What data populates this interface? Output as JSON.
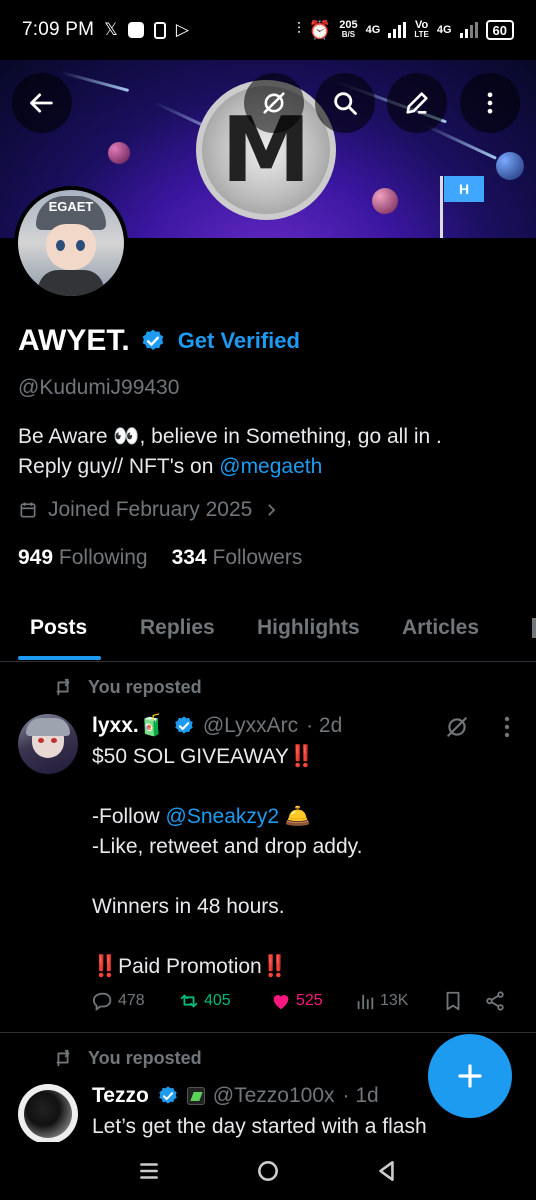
{
  "status_bar": {
    "time": "7:09 PM",
    "speed_top": "205",
    "speed_bottom": "B/S",
    "net1": "4G",
    "vo_top": "Vo",
    "vo_bottom": "LTE",
    "net2": "4G",
    "battery": "60"
  },
  "banner": {
    "back_icon": "arrow-left-icon",
    "grok_icon": "grok-icon",
    "search_icon": "search-icon",
    "edit_icon": "pencil-icon",
    "more_icon": "more-vertical-icon",
    "logo_letter": "M",
    "flag_text": "H"
  },
  "profile": {
    "avatar_cap_text": "EGAET",
    "name": "AWYET.",
    "get_verified": "Get Verified",
    "handle": "@KudumiJ99430",
    "bio_line1": "Be Aware 👀, believe in Something, go all in .",
    "bio_line2_prefix": "Reply guy// NFT's on ",
    "bio_mention": "@megaeth",
    "joined": "Joined February 2025",
    "following_count": "949",
    "following_label": "Following",
    "followers_count": "334",
    "followers_label": "Followers"
  },
  "tabs": [
    {
      "label": "Posts",
      "active": true
    },
    {
      "label": "Replies",
      "active": false
    },
    {
      "label": "Highlights",
      "active": false
    },
    {
      "label": "Articles",
      "active": false
    }
  ],
  "posts": [
    {
      "repost_label": "You reposted",
      "name": "lyxx.🧃",
      "handle": "@LyxxArc",
      "time": "· 2d",
      "line1": "$50 SOL GIVEAWAY‼️",
      "line2_prefix": "-Follow ",
      "line2_mention": "@Sneakzy2",
      "line2_suffix": " 🛎️",
      "line3": "-Like, retweet and drop addy.",
      "line4": "Winners in 48 hours.",
      "line5": "‼️Paid Promotion‼️",
      "replies": "478",
      "reposts": "405",
      "likes": "525",
      "views": "13K"
    },
    {
      "repost_label": "You reposted",
      "name": "Tezzo",
      "handle": "@Tezzo100x",
      "time": "· 1d",
      "line1": "Let’s get the day started with a flash"
    }
  ],
  "colors": {
    "accent": "#1d9bf0",
    "muted": "#71767b",
    "repost_green": "#00ba7c",
    "like_pink": "#f91880",
    "background": "#000000"
  }
}
